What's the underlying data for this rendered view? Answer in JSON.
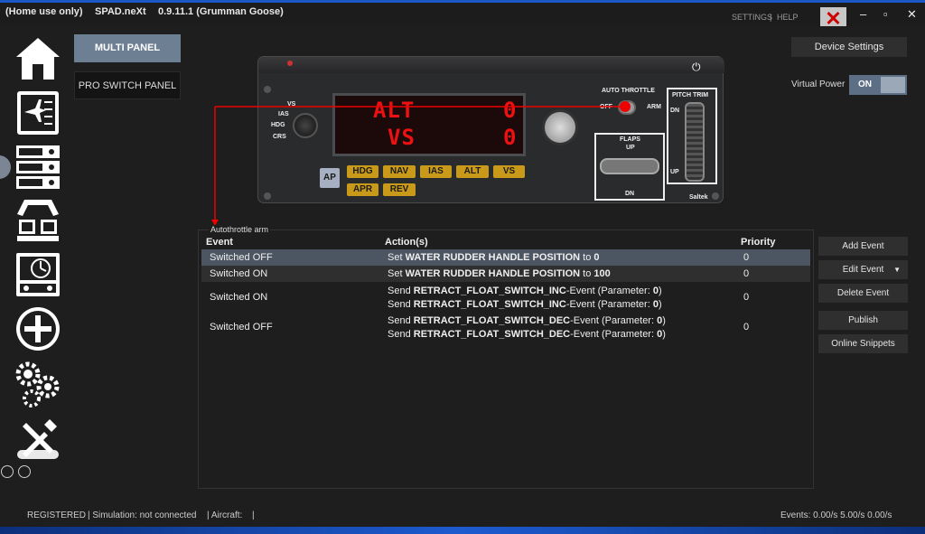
{
  "titlebar": {
    "edition": "(Home use only)",
    "app": "SPAD.neXt",
    "version": "0.9.11.1 (Grumman Goose)",
    "settings": "SETTINGS",
    "help": "HELP",
    "separator": "|"
  },
  "tabs": {
    "multi_panel": "MULTI PANEL",
    "pro_switch_panel": "PRO SWITCH PANEL"
  },
  "device": {
    "brand": "Saltek",
    "display_top_left": "ALT",
    "display_top_right": "0",
    "display_bottom_left": "VS",
    "display_bottom_right": "0",
    "selector_labels": [
      "VS",
      "IAS",
      "HDG",
      "CRS"
    ],
    "ap_label": "AP",
    "buttons_top": [
      "HDG",
      "NAV",
      "IAS",
      "ALT",
      "VS"
    ],
    "buttons_bottom": [
      "APR",
      "REV"
    ],
    "auto_throttle_label": "AUTO THROTTLE",
    "off_label": "OFF",
    "arm_label": "ARM",
    "flaps_label": "FLAPS",
    "flaps_up": "UP",
    "flaps_dn": "DN",
    "pitch_trim_label": "PITCH TRIM",
    "trim_dn": "DN",
    "trim_up": "UP"
  },
  "events": {
    "group_label": "Autothrottle arm",
    "headers": {
      "event": "Event",
      "actions": "Action(s)",
      "priority": "Priority"
    },
    "rows": [
      {
        "event": "Switched OFF",
        "a1_pre": "Set ",
        "a1_bold": "WATER RUDDER HANDLE POSITION",
        "a1_mid": " to ",
        "a1_val": "0",
        "priority": "0"
      },
      {
        "event": "Switched ON",
        "a1_pre": "Set ",
        "a1_bold": "WATER RUDDER HANDLE POSITION",
        "a1_mid": " to ",
        "a1_val": "100",
        "priority": "0"
      },
      {
        "event": "Switched ON",
        "a1_pre": "Send ",
        "a1_bold": "RETRACT_FLOAT_SWITCH_INC",
        "a1_mid": "-Event (Parameter: ",
        "a1_val": "0",
        "a1_post": ")",
        "a2_pre": "Send ",
        "a2_bold": "RETRACT_FLOAT_SWITCH_INC",
        "a2_mid": "-Event (Parameter: ",
        "a2_val": "0",
        "a2_post": ")",
        "priority": "0"
      },
      {
        "event": "Switched OFF",
        "a1_pre": "Send ",
        "a1_bold": "RETRACT_FLOAT_SWITCH_DEC",
        "a1_mid": "-Event (Parameter: ",
        "a1_val": "0",
        "a1_post": ")",
        "a2_pre": "Send ",
        "a2_bold": "RETRACT_FLOAT_SWITCH_DEC",
        "a2_mid": "-Event (Parameter: ",
        "a2_val": "0",
        "a2_post": ")",
        "priority": "0"
      }
    ]
  },
  "right_panel": {
    "device_settings": "Device Settings",
    "virtual_power_label": "Virtual Power",
    "virtual_power_state": "ON",
    "add_event": "Add Event",
    "edit_event": "Edit Event",
    "delete_event": "Delete Event",
    "publish": "Publish",
    "online_snippets": "Online Snippets"
  },
  "statusbar": {
    "registered": "REGISTERED",
    "simulation": "| Simulation: not connected",
    "aircraft": "| Aircraft:",
    "aircraft_sep": "|",
    "events": "Events: 0.00/s 5.00/s 0.00/s"
  },
  "colors": {
    "accent_tab": "#6d7f93",
    "selected_row": "#4c5663",
    "display_red": "#ee1111",
    "amber_button": "#c99a1a",
    "close_x": "#cc0000"
  },
  "icons": [
    "home-icon",
    "flight-plan-icon",
    "radio-stack-icon",
    "cockpit-icon",
    "instrument-panel-icon",
    "add-icon",
    "settings-gears-icon",
    "tools-icon",
    "save-icon",
    "cloud-icon",
    "power-icon"
  ]
}
